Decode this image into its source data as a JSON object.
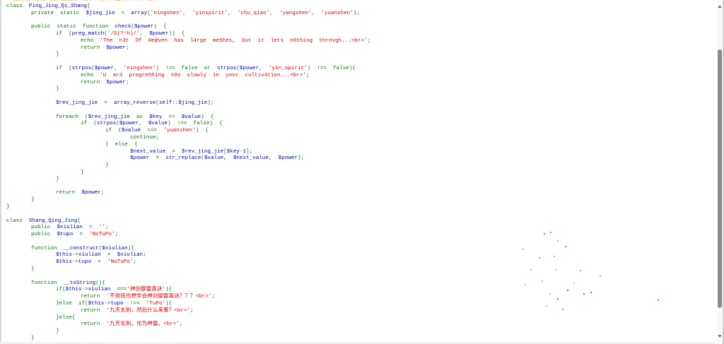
{
  "colors": {
    "keyword": "#007700",
    "default": "#0000BB",
    "string": "#DD0000",
    "comment": "#FF8000"
  },
  "code_lines": [
    [
      [
        "c",
        "//上清境共分为六层，分别为：凝神、阴神、出窍、阳神、元神"
      ]
    ],
    [
      [
        "k",
        "class  "
      ],
      [
        "v",
        "Ping_Jing_Qi_Shang"
      ],
      [
        "k",
        "{"
      ]
    ],
    [
      [
        "k",
        "\tprivate  static  "
      ],
      [
        "v",
        "$jing_jie  "
      ],
      [
        "k",
        "=  "
      ],
      [
        "v",
        "array"
      ],
      [
        "k",
        "("
      ],
      [
        "s",
        "'ningshen'"
      ],
      [
        "k",
        ",  "
      ],
      [
        "s",
        "'yinspirit'"
      ],
      [
        "k",
        ",  "
      ],
      [
        "s",
        "'chu_qiao'"
      ],
      [
        "k",
        ",  "
      ],
      [
        "s",
        "'yangshen'"
      ],
      [
        "k",
        ",  "
      ],
      [
        "s",
        "'yuanshen'"
      ],
      [
        "k",
        ");"
      ]
    ],
    [],
    [
      [
        "k",
        "\tpublic  static  function  "
      ],
      [
        "v",
        "check"
      ],
      [
        "k",
        "("
      ],
      [
        "v",
        "$power"
      ],
      [
        "k",
        ")  {"
      ]
    ],
    [
      [
        "k",
        "\t\tif  ("
      ],
      [
        "v",
        "preg_match"
      ],
      [
        "k",
        "("
      ],
      [
        "s",
        "'/S(?!h)/'"
      ],
      [
        "k",
        ",  "
      ],
      [
        "v",
        "$power"
      ],
      [
        "k",
        "))  {"
      ]
    ],
    [
      [
        "k",
        "\t\t\techo  "
      ],
      [
        "s",
        "'The  n3t  Of  He@ven  has  l4rge  me5hes,  6ut  it  lets  n0thing  throvgh...<br>'"
      ],
      [
        "k",
        ";"
      ]
    ],
    [
      [
        "k",
        "\t\t\treturn  "
      ],
      [
        "v",
        "$power"
      ],
      [
        "k",
        ";"
      ]
    ],
    [
      [
        "k",
        "\t\t}"
      ]
    ],
    [],
    [
      [
        "k",
        "\t\tif  ("
      ],
      [
        "v",
        "strpos"
      ],
      [
        "k",
        "("
      ],
      [
        "v",
        "$power"
      ],
      [
        "k",
        ",  "
      ],
      [
        "s",
        "'ningshen'"
      ],
      [
        "k",
        ")  !==  false  or  "
      ],
      [
        "v",
        "strpos"
      ],
      [
        "k",
        "("
      ],
      [
        "v",
        "$power"
      ],
      [
        "k",
        ",  "
      ],
      [
        "s",
        "'yin_spirit'"
      ],
      [
        "k",
        ")  !==  false){"
      ]
    ],
    [
      [
        "k",
        "\t\t\techo  "
      ],
      [
        "s",
        "'U  ar3  progre55ing  t0o  slowly  in  yovr  cultiv4tion...<br>'"
      ],
      [
        "k",
        ";"
      ]
    ],
    [
      [
        "k",
        "\t\t\treturn  "
      ],
      [
        "v",
        "$power"
      ],
      [
        "k",
        ";"
      ]
    ],
    [
      [
        "k",
        "\t\t}"
      ]
    ],
    [],
    [
      [
        "k",
        "\t\t"
      ],
      [
        "v",
        "$rev_jing_jie  "
      ],
      [
        "k",
        "=  "
      ],
      [
        "v",
        "array_reverse"
      ],
      [
        "k",
        "("
      ],
      [
        "v",
        "self"
      ],
      [
        "k",
        "::"
      ],
      [
        "v",
        "$jing_jie"
      ],
      [
        "k",
        ");"
      ]
    ],
    [],
    [
      [
        "k",
        "\t\tforeach  ("
      ],
      [
        "v",
        "$rev_jing_jie  "
      ],
      [
        "k",
        "as  "
      ],
      [
        "v",
        "$key  "
      ],
      [
        "k",
        "=>  "
      ],
      [
        "v",
        "$value"
      ],
      [
        "k",
        ")  {"
      ]
    ],
    [
      [
        "k",
        "\t\t\tif  ("
      ],
      [
        "v",
        "strpos"
      ],
      [
        "k",
        "("
      ],
      [
        "v",
        "$power"
      ],
      [
        "k",
        ",  "
      ],
      [
        "v",
        "$value"
      ],
      [
        "k",
        ")  !==  false)  {"
      ]
    ],
    [
      [
        "k",
        "\t\t\t\tif  ("
      ],
      [
        "v",
        "$value  "
      ],
      [
        "k",
        "===  "
      ],
      [
        "s",
        "'yuanshen'"
      ],
      [
        "k",
        ")  {"
      ]
    ],
    [
      [
        "k",
        "\t\t\t\t\tcontinue;"
      ]
    ],
    [
      [
        "k",
        "\t\t\t\t}  else  {"
      ]
    ],
    [
      [
        "k",
        "\t\t\t\t\t"
      ],
      [
        "v",
        "$next_value  "
      ],
      [
        "k",
        "=  "
      ],
      [
        "v",
        "$rev_jing_jie"
      ],
      [
        "k",
        "["
      ],
      [
        "v",
        "$key"
      ],
      [
        "k",
        "-"
      ],
      [
        "v",
        "1"
      ],
      [
        "k",
        "];"
      ]
    ],
    [
      [
        "k",
        "\t\t\t\t\t"
      ],
      [
        "v",
        "$power  "
      ],
      [
        "k",
        "=  "
      ],
      [
        "v",
        "str_replace"
      ],
      [
        "k",
        "("
      ],
      [
        "v",
        "$value"
      ],
      [
        "k",
        ",  "
      ],
      [
        "v",
        "$next_value"
      ],
      [
        "k",
        ",  "
      ],
      [
        "v",
        "$power"
      ],
      [
        "k",
        ");"
      ]
    ],
    [
      [
        "k",
        "\t\t\t\t}"
      ]
    ],
    [
      [
        "k",
        "\t\t\t}"
      ]
    ],
    [
      [
        "k",
        "\t\t}"
      ]
    ],
    [],
    [
      [
        "k",
        "\t\treturn  "
      ],
      [
        "v",
        "$power"
      ],
      [
        "k",
        ";"
      ]
    ],
    [
      [
        "k",
        "\t}"
      ]
    ],
    [
      [
        "k",
        "}"
      ]
    ],
    [],
    [
      [
        "k",
        "class  "
      ],
      [
        "v",
        "Shang_Qing_Jing"
      ],
      [
        "k",
        "{"
      ]
    ],
    [
      [
        "k",
        "\tpublic  "
      ],
      [
        "v",
        "$xiulian  "
      ],
      [
        "k",
        "=  "
      ],
      [
        "s",
        "''"
      ],
      [
        "k",
        ";"
      ]
    ],
    [
      [
        "k",
        "\tpublic  "
      ],
      [
        "v",
        "$tupo  "
      ],
      [
        "k",
        "=  "
      ],
      [
        "s",
        "'NoTuPo'"
      ],
      [
        "k",
        ";"
      ]
    ],
    [],
    [
      [
        "k",
        "\tfunction  "
      ],
      [
        "v",
        "__construct"
      ],
      [
        "k",
        "("
      ],
      [
        "v",
        "$xiulian"
      ],
      [
        "k",
        "){"
      ]
    ],
    [
      [
        "k",
        "\t\t"
      ],
      [
        "v",
        "$this"
      ],
      [
        "k",
        "->"
      ],
      [
        "v",
        "xiulian  "
      ],
      [
        "k",
        "=  "
      ],
      [
        "v",
        "$xiulian"
      ],
      [
        "k",
        ";"
      ]
    ],
    [
      [
        "k",
        "\t\t"
      ],
      [
        "v",
        "$this"
      ],
      [
        "k",
        "->"
      ],
      [
        "v",
        "tupo  "
      ],
      [
        "k",
        "=  "
      ],
      [
        "s",
        "'NoTuPo'"
      ],
      [
        "k",
        ";"
      ]
    ],
    [
      [
        "k",
        "\t}"
      ]
    ],
    [],
    [
      [
        "k",
        "\tfunction  "
      ],
      [
        "v",
        "__toString"
      ],
      [
        "k",
        "(){"
      ]
    ],
    [
      [
        "k",
        "\t\tif("
      ],
      [
        "v",
        "$this"
      ],
      [
        "k",
        "->"
      ],
      [
        "v",
        "xiulian  "
      ],
      [
        "k",
        "==="
      ],
      [
        "s",
        "'神剑御雷真诀'"
      ],
      [
        "k",
        "){"
      ]
    ],
    [
      [
        "k",
        "\t\t\treturn  "
      ],
      [
        "s",
        "'不修炼也想学会神剑御雷真诀？？？<br>'"
      ],
      [
        "k",
        ";"
      ]
    ],
    [
      [
        "k",
        "\t\t}else  if("
      ],
      [
        "v",
        "$this"
      ],
      [
        "k",
        "->"
      ],
      [
        "v",
        "tupo  "
      ],
      [
        "k",
        "!==  "
      ],
      [
        "s",
        "'TuPo'"
      ],
      [
        "k",
        "){"
      ]
    ],
    [
      [
        "k",
        "\t\t\treturn  "
      ],
      [
        "s",
        "'九天玄剎，然后什么来着？<br>'"
      ],
      [
        "k",
        ";"
      ]
    ],
    [
      [
        "k",
        "\t\t}else{"
      ]
    ],
    [
      [
        "k",
        "\t\t\treturn  "
      ],
      [
        "s",
        "'九天玄剎，化为神雷。<br>'"
      ],
      [
        "k",
        ";"
      ]
    ],
    [
      [
        "k",
        "\t\t}"
      ]
    ],
    [
      [
        "k",
        "\t}"
      ]
    ]
  ]
}
